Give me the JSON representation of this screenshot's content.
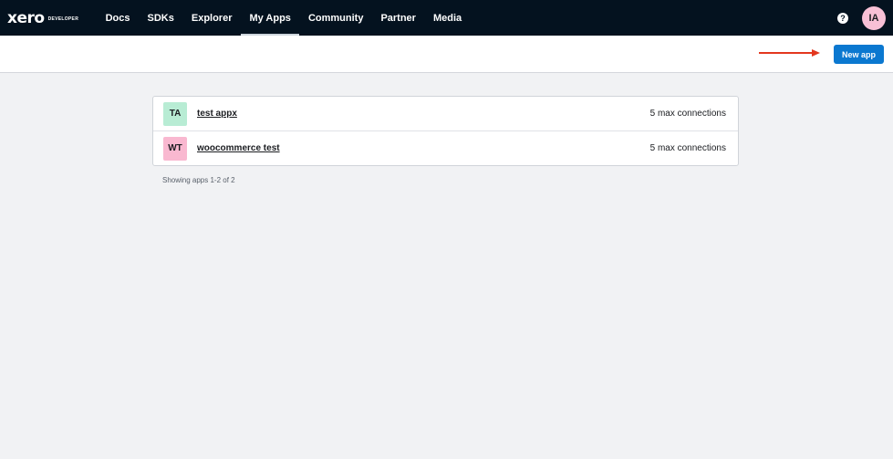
{
  "nav": {
    "logo_word": "xero",
    "logo_sub": "DEVELOPER",
    "items": [
      {
        "label": "Docs"
      },
      {
        "label": "SDKs"
      },
      {
        "label": "Explorer"
      },
      {
        "label": "My Apps",
        "active": true
      },
      {
        "label": "Community"
      },
      {
        "label": "Partner"
      },
      {
        "label": "Media"
      }
    ],
    "help_icon": "?",
    "avatar_initials": "IA"
  },
  "toolbar": {
    "new_app_label": "New app",
    "annotation": "red-arrow-pointing-right"
  },
  "apps": [
    {
      "initials": "TA",
      "name": "test appx",
      "connections": "5 max connections",
      "badge_color": "#b8ecd4"
    },
    {
      "initials": "WT",
      "name": "woocommerce test",
      "connections": "5 max connections",
      "badge_color": "#f9b8d0"
    }
  ],
  "footer": {
    "showing": "Showing apps 1-2 of 2"
  },
  "colors": {
    "nav_bg": "#04121f",
    "page_bg": "#f1f2f4",
    "primary_button": "#0b78d0",
    "arrow": "#e3371e",
    "avatar_bg": "#f8c0d6"
  }
}
